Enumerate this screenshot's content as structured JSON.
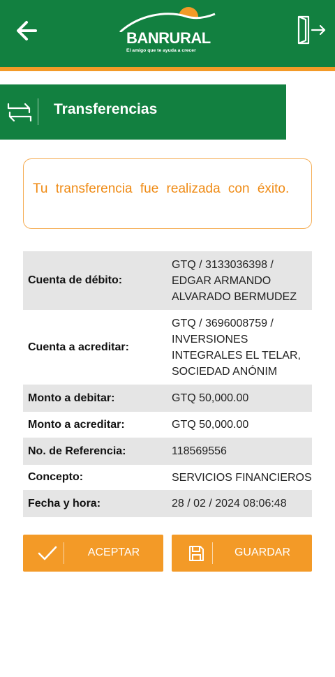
{
  "header": {
    "brand_name": "BANRURAL",
    "brand_tagline": "El amigo que te ayuda a crecer",
    "back_icon": "arrow-left-icon",
    "exit_icon": "logout-door-icon",
    "colors": {
      "green": "#128040",
      "orange": "#f39a27"
    }
  },
  "section": {
    "title": "Transferencias",
    "icon": "transfer-arrows-icon"
  },
  "alert": {
    "message": "Tu transferencia fue realizada con éxito."
  },
  "details": {
    "rows": [
      {
        "label": "Cuenta de débito:",
        "value": "GTQ / 3133036398 / EDGAR ARMANDO ALVARADO BERMUDEZ"
      },
      {
        "label": "Cuenta a acreditar:",
        "value": "GTQ / 3696008759 / INVERSIONES INTEGRALES EL TELAR, SOCIEDAD ANÓNIM"
      },
      {
        "label": "Monto a debitar:",
        "value": "GTQ 50,000.00"
      },
      {
        "label": "Monto a acreditar:",
        "value": "GTQ 50,000.00"
      },
      {
        "label": "No. de Referencia:",
        "value": "118569556"
      },
      {
        "label": "Concepto:",
        "value": "SERVICIOS FINANCIEROS"
      },
      {
        "label": "Fecha y hora:",
        "value": "28 / 02 / 2024  08:06:48"
      }
    ]
  },
  "actions": {
    "accept_label": "ACEPTAR",
    "accept_icon": "checkmark-icon",
    "save_label": "GUARDAR",
    "save_icon": "floppy-disk-icon"
  }
}
